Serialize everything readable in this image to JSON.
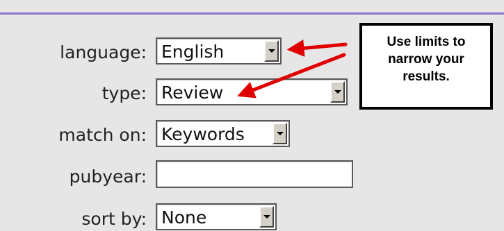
{
  "form": {
    "language": {
      "label": "language:",
      "value": "English"
    },
    "type": {
      "label": "type:",
      "value": "Review"
    },
    "match_on": {
      "label": "match on:",
      "value": "Keywords"
    },
    "pubyear": {
      "label": "pubyear:",
      "value": "",
      "placeholder": ""
    },
    "sort_by": {
      "label": "sort by:",
      "value": "None"
    }
  },
  "callout": {
    "text": "Use limits to narrow your results."
  },
  "colors": {
    "top_rule": "#8a73c8",
    "arrow": "#e00000",
    "background": "#e6e6e6"
  }
}
